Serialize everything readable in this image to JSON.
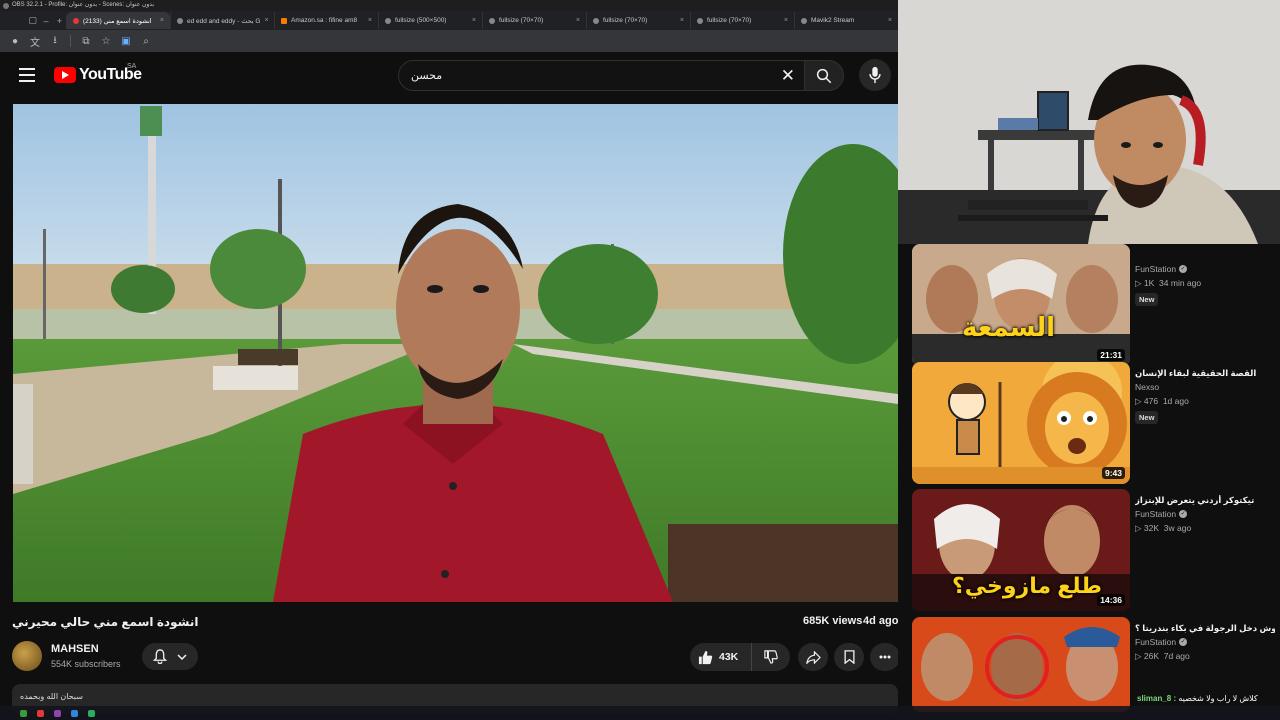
{
  "obs": {
    "title": "OBS 32.2.1 - Profile: بدون عنوان - Scenes: بدون عنوان"
  },
  "tabs": [
    {
      "label": "انشودة اسمع مني (2133)",
      "active": true,
      "favicon": "youtube-favicon"
    },
    {
      "label": "ed edd and eddy - بحث G",
      "active": false,
      "favicon": "google-favicon"
    },
    {
      "label": "Amazon.sa : fifine am8",
      "active": false,
      "favicon": "amazon-favicon"
    },
    {
      "label": "fullsize (500×500)",
      "active": false,
      "favicon": "image-favicon"
    },
    {
      "label": "fullsize (70×70)",
      "active": false,
      "favicon": "image-favicon"
    },
    {
      "label": "fullsize (70×70)",
      "active": false,
      "favicon": "image-favicon"
    },
    {
      "label": "fullsize (70×70)",
      "active": false,
      "favicon": "image-favicon"
    },
    {
      "label": "Mavik2 Stream",
      "active": false,
      "favicon": "image-favicon"
    }
  ],
  "header": {
    "logo": "YouTube",
    "region": "SA",
    "search_value": "محسن"
  },
  "video": {
    "title": "انشودة اسمع مني حالي محيرني",
    "views": "685K views",
    "ago": "4d ago",
    "channel": "MAHSEN",
    "subscribers": "554K subscribers",
    "likes": "43K",
    "description": "سبحان الله وبحمده"
  },
  "sidebar": {
    "recs": [
      {
        "title": "",
        "channel": "FunStation",
        "views": "1K",
        "ago": "34 min ago",
        "badge": "New",
        "duration": "21:31",
        "overlay": "السمعة"
      },
      {
        "title": "القصة الحقيقية لبقاء الإنسان",
        "channel": "Nexso",
        "views": "476",
        "ago": "1d ago",
        "badge": "New",
        "duration": "9:43",
        "overlay": ""
      },
      {
        "title": "تيكتوكر أردني يتعرض للإبتزاز",
        "channel": "FunStation",
        "views": "32K",
        "ago": "3w ago",
        "badge": "",
        "duration": "14:36",
        "overlay": "طلع مازوخي؟"
      },
      {
        "title": "وش دخل الرجولة في بكاء بندريتا ؟",
        "channel": "FunStation",
        "views": "26K",
        "ago": "7d ago",
        "badge": "",
        "duration": "",
        "overlay": ""
      }
    ],
    "chat": {
      "user": "sliman_8 :",
      "message": "كلاش لا راب ولا شخصيه"
    }
  },
  "colors": {
    "accent": "#ff0000",
    "bg": "#0f0f0f",
    "shirt": "#a3172a"
  }
}
